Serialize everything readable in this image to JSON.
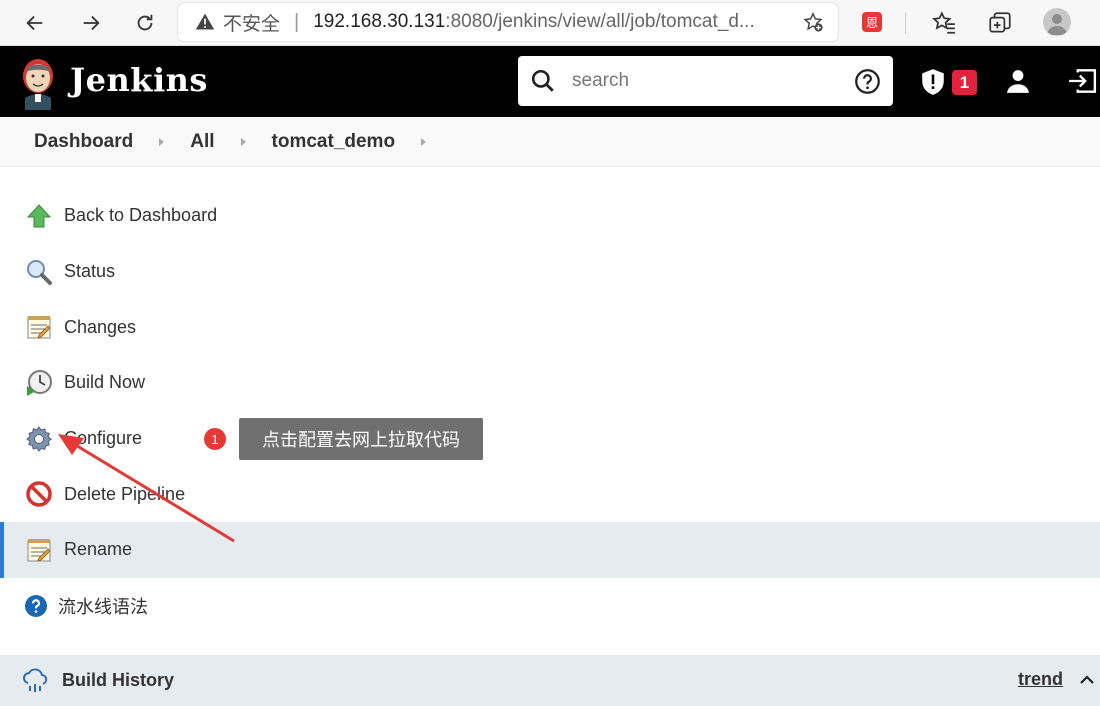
{
  "browser": {
    "security_label": "不安全",
    "url_host": "192.168.30.131",
    "url_rest": ":8080/jenkins/view/all/job/tomcat_d...",
    "extension_label": "恩"
  },
  "header": {
    "title": "Jenkins",
    "search_placeholder": "search",
    "alert_count": "1"
  },
  "breadcrumbs": [
    "Dashboard",
    "All",
    "tomcat_demo"
  ],
  "tasks": [
    {
      "label": "Back to Dashboard",
      "icon": "up-arrow-icon"
    },
    {
      "label": "Status",
      "icon": "magnifier-icon"
    },
    {
      "label": "Changes",
      "icon": "notepad-icon"
    },
    {
      "label": "Build Now",
      "icon": "clock-icon"
    },
    {
      "label": "Configure",
      "icon": "gear-icon"
    },
    {
      "label": "Delete Pipeline",
      "icon": "no-entry-icon"
    },
    {
      "label": "Rename",
      "icon": "notepad-icon"
    },
    {
      "label": "流水线语法",
      "icon": "help-icon"
    }
  ],
  "annotation": {
    "step": "1",
    "text": "点击配置去网上拉取代码"
  },
  "build_history": {
    "title": "Build History",
    "trend_label": "trend"
  },
  "colors": {
    "header_bg": "#000000",
    "active_item": "#e6ebef",
    "active_bar": "#2b7cd3",
    "badge": "#e3223d",
    "annotation_arrow": "#e53935"
  }
}
